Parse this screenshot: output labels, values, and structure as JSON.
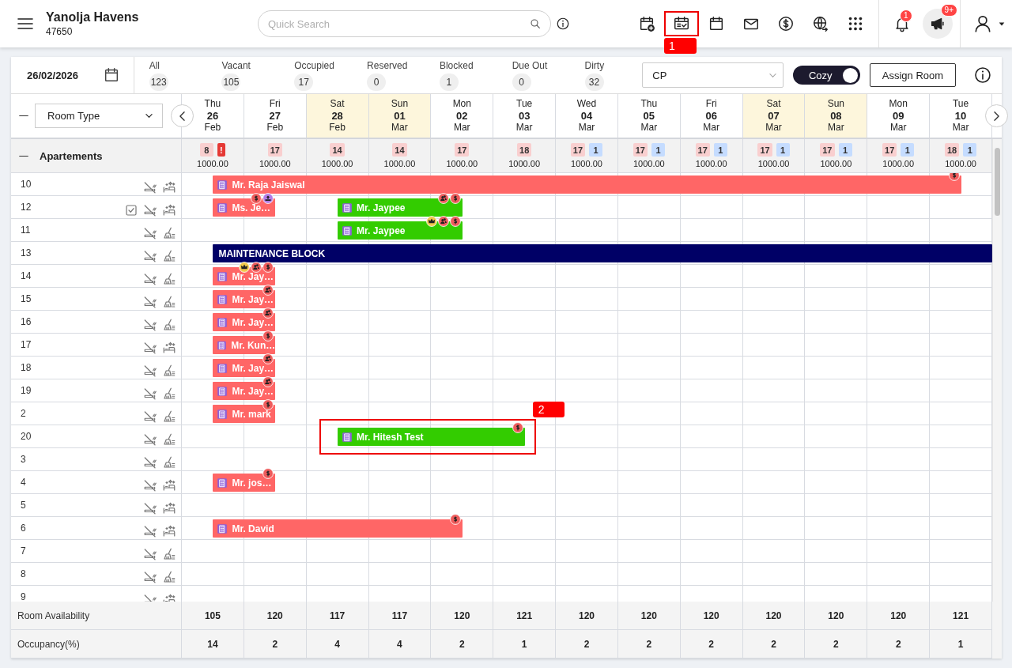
{
  "header": {
    "title": "Yanolja Havens",
    "subtitle": "47650",
    "search": {
      "placeholder": "Quick Search"
    },
    "toolbar": [
      {
        "kind": "calendar-add"
      },
      {
        "kind": "calendar-check",
        "annotation": "1"
      },
      {
        "kind": "calendar"
      },
      {
        "kind": "mail"
      },
      {
        "kind": "dollar"
      },
      {
        "kind": "globe"
      },
      {
        "kind": "apps"
      }
    ],
    "notifications": {
      "count": "1"
    },
    "announcements": {
      "count": "9+"
    }
  },
  "filter_bar": {
    "date": "26/02/2026",
    "statuses": [
      {
        "label": "All",
        "count": "123"
      },
      {
        "label": "Vacant",
        "count": "105"
      },
      {
        "label": "Occupied",
        "count": "17"
      },
      {
        "label": "Reserved",
        "count": "0"
      },
      {
        "label": "Blocked",
        "count": "1"
      },
      {
        "label": "Due Out",
        "count": "0"
      },
      {
        "label": "Dirty",
        "count": "32"
      }
    ],
    "rate_plan": "CP",
    "view_toggle": {
      "label": "Cozy",
      "on": true
    },
    "assign_button": "Assign Room"
  },
  "scheduler": {
    "room_type_filter": "Room Type",
    "days": [
      {
        "weekday": "Thu",
        "date": "26",
        "month": "Feb",
        "weekend": false,
        "chips": [
          {
            "text": "8",
            "kind": "occupied"
          },
          {
            "text": "!",
            "kind": "alert"
          }
        ],
        "rate": "1000.00"
      },
      {
        "weekday": "Fri",
        "date": "27",
        "month": "Feb",
        "weekend": false,
        "chips": [
          {
            "text": "17",
            "kind": "occupied"
          }
        ],
        "rate": "1000.00"
      },
      {
        "weekday": "Sat",
        "date": "28",
        "month": "Feb",
        "weekend": true,
        "chips": [
          {
            "text": "14",
            "kind": "occupied"
          }
        ],
        "rate": "1000.00"
      },
      {
        "weekday": "Sun",
        "date": "01",
        "month": "Mar",
        "weekend": true,
        "chips": [
          {
            "text": "14",
            "kind": "occupied"
          }
        ],
        "rate": "1000.00"
      },
      {
        "weekday": "Mon",
        "date": "02",
        "month": "Mar",
        "weekend": false,
        "chips": [
          {
            "text": "17",
            "kind": "occupied"
          }
        ],
        "rate": "1000.00"
      },
      {
        "weekday": "Tue",
        "date": "03",
        "month": "Mar",
        "weekend": false,
        "chips": [
          {
            "text": "18",
            "kind": "occupied"
          }
        ],
        "rate": "1000.00"
      },
      {
        "weekday": "Wed",
        "date": "04",
        "month": "Mar",
        "weekend": false,
        "chips": [
          {
            "text": "17",
            "kind": "occupied"
          },
          {
            "text": "1",
            "kind": "blocked"
          }
        ],
        "rate": "1000.00"
      },
      {
        "weekday": "Thu",
        "date": "05",
        "month": "Mar",
        "weekend": false,
        "chips": [
          {
            "text": "17",
            "kind": "occupied"
          },
          {
            "text": "1",
            "kind": "blocked"
          }
        ],
        "rate": "1000.00"
      },
      {
        "weekday": "Fri",
        "date": "06",
        "month": "Mar",
        "weekend": false,
        "chips": [
          {
            "text": "17",
            "kind": "occupied"
          },
          {
            "text": "1",
            "kind": "blocked"
          }
        ],
        "rate": "1000.00"
      },
      {
        "weekday": "Sat",
        "date": "07",
        "month": "Mar",
        "weekend": true,
        "chips": [
          {
            "text": "17",
            "kind": "occupied"
          },
          {
            "text": "1",
            "kind": "blocked"
          }
        ],
        "rate": "1000.00"
      },
      {
        "weekday": "Sun",
        "date": "08",
        "month": "Mar",
        "weekend": true,
        "chips": [
          {
            "text": "17",
            "kind": "occupied"
          },
          {
            "text": "1",
            "kind": "blocked"
          }
        ],
        "rate": "1000.00"
      },
      {
        "weekday": "Mon",
        "date": "09",
        "month": "Mar",
        "weekend": false,
        "chips": [
          {
            "text": "17",
            "kind": "occupied"
          },
          {
            "text": "1",
            "kind": "blocked"
          }
        ],
        "rate": "1000.00"
      },
      {
        "weekday": "Tue",
        "date": "10",
        "month": "Mar",
        "weekend": false,
        "chips": [
          {
            "text": "18",
            "kind": "occupied"
          },
          {
            "text": "1",
            "kind": "blocked"
          }
        ],
        "rate": "1000.00"
      }
    ],
    "group": {
      "name": "Apartements",
      "expanded": true
    },
    "rooms": [
      {
        "number": "10",
        "checked": false,
        "smoking": false,
        "kind": "clean",
        "bookings": [
          {
            "kind": "booking",
            "guest": "Mr. Raja Jaiswal",
            "color": "#ff6666",
            "badges": [
              {
                "kind": "dollar"
              }
            ]
          }
        ]
      },
      {
        "number": "12",
        "checked": true,
        "smoking": false,
        "kind": "clean",
        "bookings": [
          {
            "kind": "booking",
            "guest": "Ms. Je…",
            "color": "#ff6666",
            "badges": [
              {
                "kind": "dollar"
              },
              {
                "kind": "upload"
              }
            ]
          },
          {
            "kind": "booking",
            "guest": "Mr. Jaypee",
            "color": "#33cc00",
            "badges": [
              {
                "kind": "group"
              },
              {
                "kind": "dollar"
              }
            ]
          }
        ]
      },
      {
        "number": "11",
        "checked": false,
        "smoking": false,
        "kind": "dirty",
        "bookings": [
          {
            "kind": "booking",
            "guest": "Mr. Jaypee",
            "color": "#33cc00",
            "badges": [
              {
                "kind": "crown"
              },
              {
                "kind": "group"
              },
              {
                "kind": "dollar"
              }
            ]
          }
        ]
      },
      {
        "number": "13",
        "checked": false,
        "smoking": false,
        "kind": "dirty",
        "bookings": [
          {
            "kind": "block",
            "guest": "MAINTENANCE BLOCK",
            "color": "#000066"
          }
        ]
      },
      {
        "number": "14",
        "checked": false,
        "smoking": false,
        "kind": "dirty",
        "bookings": [
          {
            "kind": "booking",
            "guest": "Mr. Jay…",
            "color": "#ff6666",
            "badges": [
              {
                "kind": "crown"
              },
              {
                "kind": "group"
              },
              {
                "kind": "dollar"
              }
            ]
          }
        ]
      },
      {
        "number": "15",
        "checked": false,
        "smoking": false,
        "kind": "dirty",
        "bookings": [
          {
            "kind": "booking",
            "guest": "Mr. Jay…",
            "color": "#ff6666",
            "badges": [
              {
                "kind": "group"
              }
            ]
          }
        ]
      },
      {
        "number": "16",
        "checked": false,
        "smoking": false,
        "kind": "dirty",
        "bookings": [
          {
            "kind": "booking",
            "guest": "Mr. Jay…",
            "color": "#ff6666",
            "badges": [
              {
                "kind": "group"
              }
            ]
          }
        ]
      },
      {
        "number": "17",
        "checked": false,
        "smoking": false,
        "kind": "clean",
        "bookings": [
          {
            "kind": "booking",
            "guest": "Mr. Kun…",
            "color": "#ff6666",
            "badges": [
              {
                "kind": "dollar"
              }
            ]
          }
        ]
      },
      {
        "number": "18",
        "checked": false,
        "smoking": false,
        "kind": "dirty",
        "bookings": [
          {
            "kind": "booking",
            "guest": "Mr. Jay…",
            "color": "#ff6666",
            "badges": [
              {
                "kind": "group"
              }
            ]
          }
        ]
      },
      {
        "number": "19",
        "checked": false,
        "smoking": false,
        "kind": "dirty",
        "bookings": [
          {
            "kind": "booking",
            "guest": "Mr. Jay…",
            "color": "#ff6666",
            "badges": [
              {
                "kind": "group"
              }
            ]
          }
        ]
      },
      {
        "number": "2",
        "checked": false,
        "smoking": false,
        "kind": "dirty",
        "bookings": [
          {
            "kind": "booking",
            "guest": "Mr. mark",
            "color": "#ff6666",
            "badges": [
              {
                "kind": "dollar"
              }
            ]
          }
        ]
      },
      {
        "number": "20",
        "checked": false,
        "smoking": false,
        "kind": "dirty",
        "bookings": [
          {
            "kind": "booking",
            "guest": "Mr. Hitesh Test",
            "color": "#33cc00",
            "annotation": "2",
            "badges": [
              {
                "kind": "dollar"
              }
            ]
          }
        ]
      },
      {
        "number": "3",
        "checked": false,
        "smoking": false,
        "kind": "dirty"
      },
      {
        "number": "4",
        "checked": false,
        "smoking": false,
        "kind": "clean",
        "bookings": [
          {
            "kind": "booking",
            "guest": "Mr. jos…",
            "color": "#ff6666",
            "badges": [
              {
                "kind": "dollar"
              }
            ]
          }
        ]
      },
      {
        "number": "5",
        "checked": false,
        "smoking": false,
        "kind": "clean"
      },
      {
        "number": "6",
        "checked": false,
        "smoking": false,
        "kind": "clean",
        "bookings": [
          {
            "kind": "booking",
            "guest": "Mr. David",
            "color": "#ff6666",
            "badges": [
              {
                "kind": "dollar"
              }
            ]
          }
        ]
      },
      {
        "number": "7",
        "checked": false,
        "smoking": false,
        "kind": "dirty"
      },
      {
        "number": "8",
        "checked": false,
        "smoking": false,
        "kind": "dirty"
      },
      {
        "number": "9",
        "checked": false,
        "smoking": false,
        "kind": "clean"
      }
    ],
    "footer": [
      {
        "label": "Room Availability",
        "values": [
          "105",
          "120",
          "117",
          "117",
          "120",
          "121",
          "120",
          "120",
          "120",
          "120",
          "120",
          "120",
          "121"
        ]
      },
      {
        "label": "Occupancy(%)",
        "values": [
          "14",
          "2",
          "4",
          "4",
          "2",
          "1",
          "2",
          "2",
          "2",
          "2",
          "2",
          "2",
          "1"
        ]
      }
    ]
  }
}
